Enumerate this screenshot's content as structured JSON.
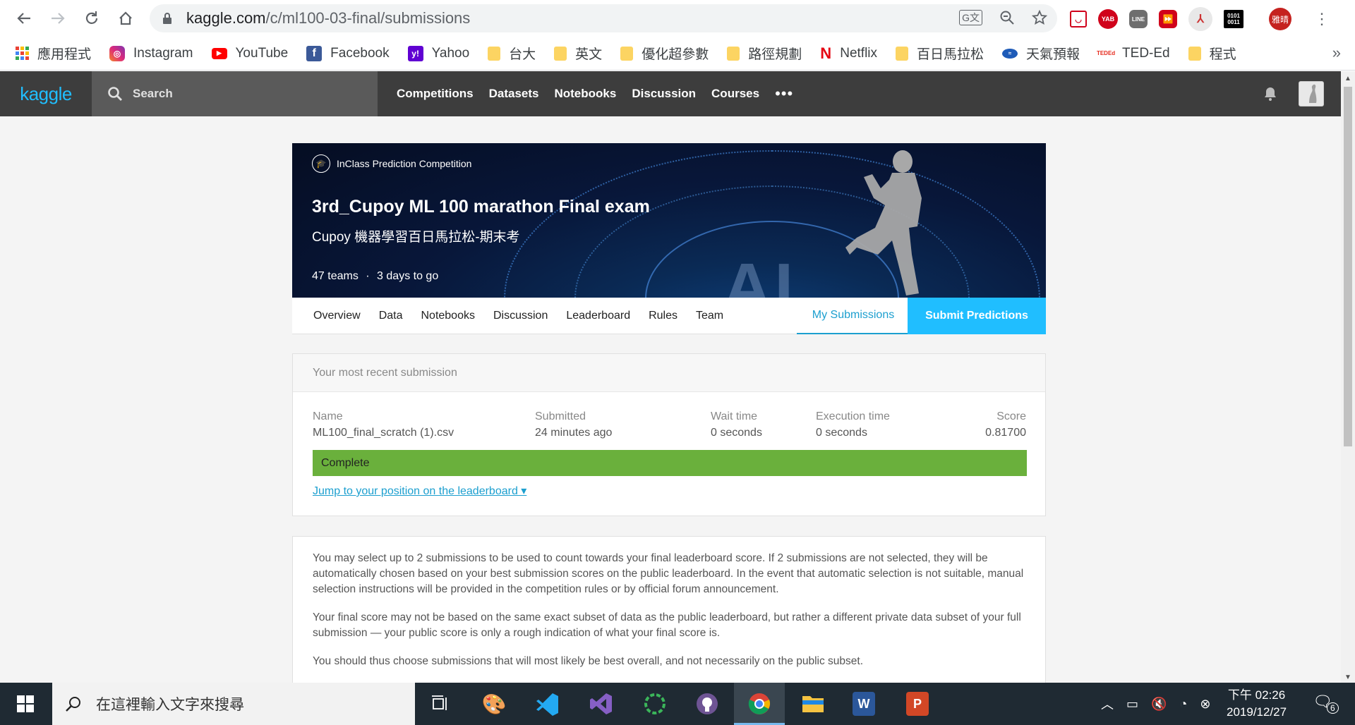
{
  "browser": {
    "url_host": "kaggle.com",
    "url_path": "/c/ml100-03-final/submissions",
    "profile_label": "雅晴",
    "extensions": [
      "pocket-icon",
      "yab-icon",
      "line-icon",
      "fast-forward-icon",
      "pdf-icon",
      "binary-icon"
    ],
    "ext_binary_text": "0101\n0011",
    "ext_yab_text": "YAB"
  },
  "bookmarks": [
    {
      "label": "應用程式",
      "icon": "apps-icon"
    },
    {
      "label": "Instagram",
      "icon": "instagram-icon"
    },
    {
      "label": "YouTube",
      "icon": "youtube-icon"
    },
    {
      "label": "Facebook",
      "icon": "facebook-icon"
    },
    {
      "label": "Yahoo",
      "icon": "yahoo-icon"
    },
    {
      "label": "台大",
      "icon": "folder-icon"
    },
    {
      "label": "英文",
      "icon": "folder-icon"
    },
    {
      "label": "優化超參數",
      "icon": "folder-icon"
    },
    {
      "label": "路徑規劃",
      "icon": "folder-icon"
    },
    {
      "label": "Netflix",
      "icon": "netflix-icon"
    },
    {
      "label": "百日馬拉松",
      "icon": "folder-icon"
    },
    {
      "label": "天氣預報",
      "icon": "weather-icon"
    },
    {
      "label": "TED-Ed",
      "icon": "ted-icon"
    },
    {
      "label": "程式",
      "icon": "folder-icon"
    }
  ],
  "kaggle": {
    "logo": "kaggle",
    "search_placeholder": "Search",
    "nav": [
      "Competitions",
      "Datasets",
      "Notebooks",
      "Discussion",
      "Courses"
    ],
    "more": "•••"
  },
  "competition": {
    "badge": "InClass Prediction Competition",
    "title": "3rd_Cupoy ML 100 marathon Final exam",
    "subtitle": "Cupoy 機器學習百日馬拉松-期末考",
    "teams": "47 teams",
    "separator": "·",
    "time_left": "3 days to go",
    "banner_text": "AI",
    "tabs": [
      "Overview",
      "Data",
      "Notebooks",
      "Discussion",
      "Leaderboard",
      "Rules",
      "Team"
    ],
    "my_submissions": "My Submissions",
    "submit_button": "Submit Predictions"
  },
  "recent": {
    "heading": "Your most recent submission",
    "name_label": "Name",
    "name_value": "ML100_final_scratch (1).csv",
    "submitted_label": "Submitted",
    "submitted_value": "24 minutes ago",
    "wait_label": "Wait time",
    "wait_value": "0 seconds",
    "exec_label": "Execution time",
    "exec_value": "0 seconds",
    "score_label": "Score",
    "score_value": "0.81700",
    "status": "Complete",
    "status_color": "#6ab03c",
    "jump_link": "Jump to your position on the leaderboard ▾"
  },
  "info": {
    "p1": "You may select up to 2 submissions to be used to count towards your final leaderboard score. If 2 submissions are not selected, they will be automatically chosen based on your best submission scores on the public leaderboard. In the event that automatic selection is not suitable, manual selection instructions will be provided in the competition rules or by official forum announcement.",
    "p2": "Your final score may not be based on the same exact subset of data as the public leaderboard, but rather a different private data subset of your full submission — your public score is only a rough indication of what your final score is.",
    "p3": "You should thus choose submissions that will most likely be best overall, and not necessarily on the public subset."
  },
  "taskbar": {
    "search_placeholder": "在這裡輸入文字來搜尋",
    "apps": [
      "task-view-icon",
      "paint-icon",
      "vscode-icon",
      "visual-studio-icon",
      "circle-app-icon",
      "github-icon",
      "chrome-icon",
      "file-explorer-icon",
      "word-icon",
      "powerpoint-icon"
    ],
    "time": "下午 02:26",
    "date": "2019/12/27",
    "notifications": "6"
  },
  "colors": {
    "kaggle_blue": "#20beff",
    "header_bg": "#3d3d3d",
    "complete_green": "#6ab03c"
  }
}
